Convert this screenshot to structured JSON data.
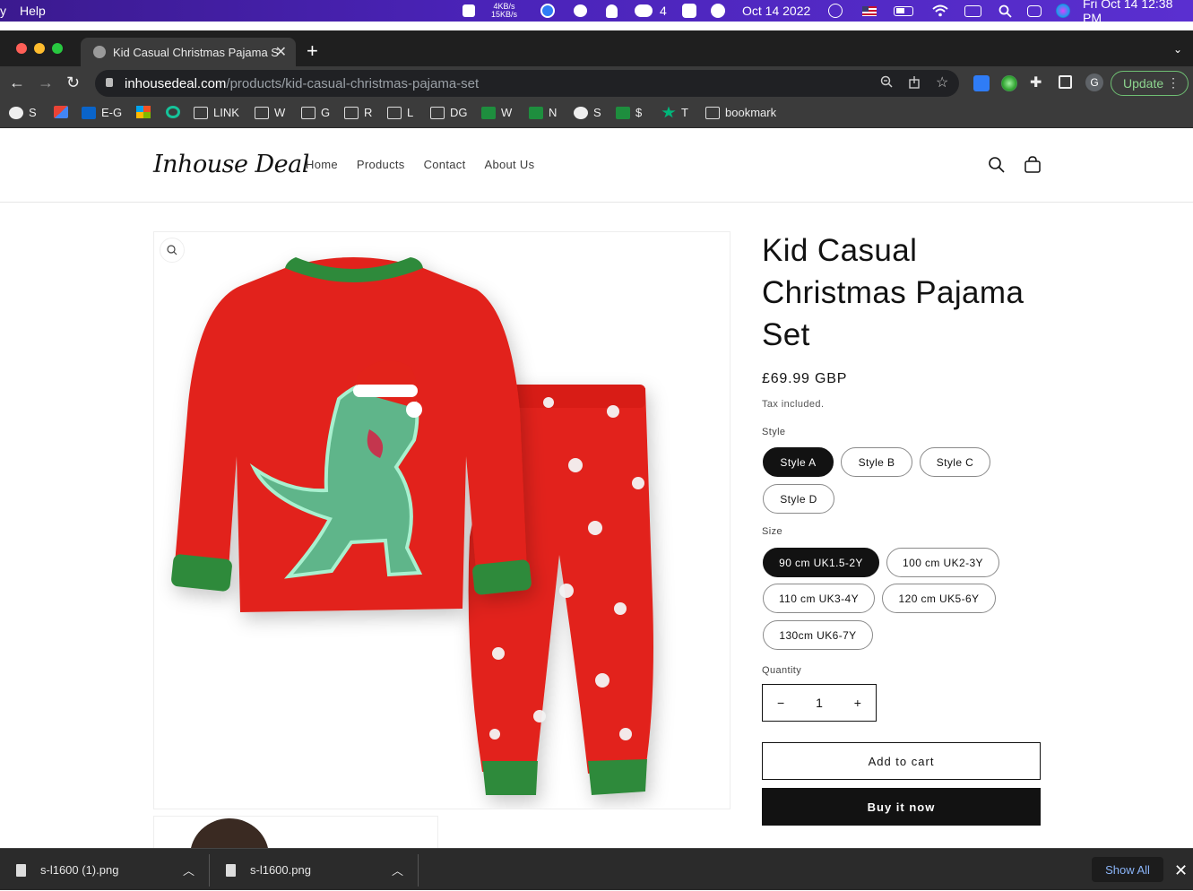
{
  "menubar": {
    "left_char": "y",
    "help": "Help",
    "net_up": "4KB/s",
    "net_down": "15KB/s",
    "wechat_count": "4",
    "date_center": "Oct 14 2022",
    "datetime": "Fri Oct 14  12:38 PM"
  },
  "tab": {
    "title": "Kid Casual Christmas Pajama S",
    "close": "✕"
  },
  "toolbar": {
    "url_host": "inhousedeal.com",
    "url_path": "/products/kid-casual-christmas-pajama-set",
    "update_label": "Update",
    "profile_letter": "G"
  },
  "bookmarks": [
    {
      "label": "S",
      "icon": "globe-icon"
    },
    {
      "label": "",
      "icon": "gmail-icon"
    },
    {
      "label": "E-G",
      "icon": "outlook-icon"
    },
    {
      "label": "",
      "icon": "microsoft-icon"
    },
    {
      "label": "",
      "icon": "grammarly-icon"
    },
    {
      "label": "LINK",
      "icon": "folder-icon"
    },
    {
      "label": "W",
      "icon": "folder-icon"
    },
    {
      "label": "G",
      "icon": "folder-icon"
    },
    {
      "label": "R",
      "icon": "folder-icon"
    },
    {
      "label": "L",
      "icon": "folder-icon"
    },
    {
      "label": "DG",
      "icon": "folder-icon"
    },
    {
      "label": "W",
      "icon": "sheets-icon"
    },
    {
      "label": "N",
      "icon": "sheets-icon"
    },
    {
      "label": "S",
      "icon": "globe-icon"
    },
    {
      "label": "$",
      "icon": "sheets-icon"
    },
    {
      "label": "T",
      "icon": "star-icon"
    },
    {
      "label": "bookmark",
      "icon": "folder-icon"
    }
  ],
  "store": {
    "logo": "Inhouse Deal",
    "nav": [
      "Home",
      "Products",
      "Contact",
      "About Us"
    ]
  },
  "product": {
    "title": "Kid Casual Christmas Pajama Set",
    "price": "£69.99 GBP",
    "tax_note": "Tax included.",
    "style_label": "Style",
    "styles": [
      "Style A",
      "Style B",
      "Style C",
      "Style D"
    ],
    "selected_style": "Style A",
    "size_label": "Size",
    "sizes": [
      "90 cm UK1.5-2Y",
      "100 cm UK2-3Y",
      "110 cm UK3-4Y",
      "120 cm UK5-6Y",
      "130cm UK6-7Y"
    ],
    "selected_size": "90 cm UK1.5-2Y",
    "quantity_label": "Quantity",
    "quantity": "1",
    "minus": "−",
    "plus": "+",
    "add_to_cart": "Add to cart",
    "buy_now": "Buy it now"
  },
  "downloads": {
    "items": [
      "s-l1600 (1).png",
      "s-l1600.png"
    ],
    "show_all": "Show All"
  },
  "colors": {
    "pajama_red": "#e2231a",
    "pajama_green": "#2f8a3a",
    "dino_green": "#5fb58a",
    "menubar_purple": "#4a23b8"
  }
}
